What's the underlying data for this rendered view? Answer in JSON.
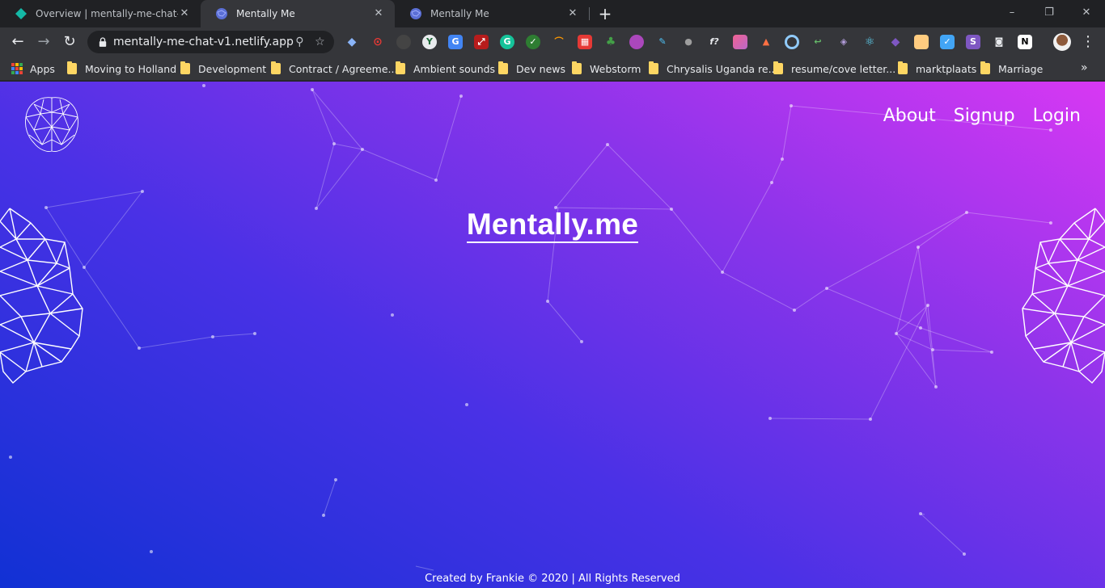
{
  "tabs": [
    {
      "title": "Overview | mentally-me-chat-v1",
      "favicon": "netlify-diamond-icon",
      "active": false
    },
    {
      "title": "Mentally Me",
      "favicon": "brain-globe-icon",
      "active": true
    },
    {
      "title": "Mentally Me",
      "favicon": "brain-globe-icon",
      "active": false
    }
  ],
  "toolbar": {
    "url": "mentally-me-chat-v1.netlify.app"
  },
  "bookmarks": [
    "Apps",
    "Moving to Holland",
    "Development",
    "Contract / Agreeme...",
    "Ambient sounds",
    "Dev news",
    "Webstorm",
    "Chrysalis Uganda re...",
    "resume/cove letter...",
    "marktplaats",
    "Marriage"
  ],
  "site": {
    "nav": [
      "About",
      "Signup",
      "Login"
    ],
    "title": "Mentally.me",
    "footer": "Created by Frankie © 2020 | All Rights Reserved"
  },
  "colors": {
    "gradient_start": "#1131d4",
    "gradient_end": "#d838f3",
    "chrome_dark": "#202124",
    "chrome_toolbar": "#35363a"
  }
}
